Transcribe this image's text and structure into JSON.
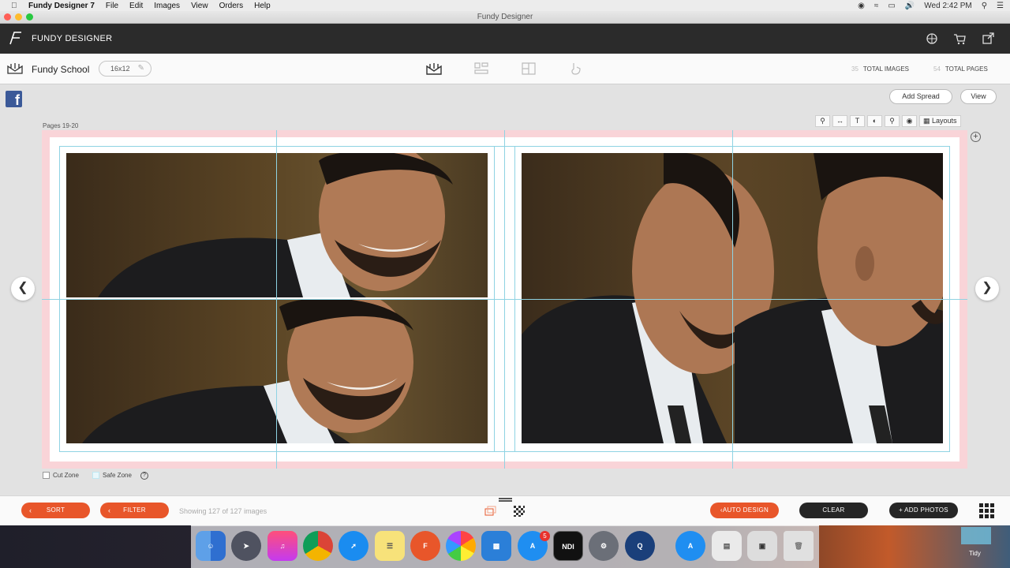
{
  "menubar": {
    "app": "Fundy Designer 7",
    "items": [
      "File",
      "Edit",
      "Images",
      "View",
      "Orders",
      "Help"
    ],
    "clock": "Wed 2:42 PM"
  },
  "window": {
    "title": "Fundy Designer"
  },
  "header": {
    "app_name": "FUNDY DESIGNER"
  },
  "toolbar": {
    "project": "Fundy School",
    "size": "16x12",
    "total_images_count": "35",
    "total_images_label": "TOTAL IMAGES",
    "total_pages_count": "54",
    "total_pages_label": "TOTAL PAGES"
  },
  "workspace": {
    "add_spread": "Add Spread",
    "view": "View",
    "pages_label": "Pages 19-20",
    "layouts": "Layouts",
    "cut_zone": "Cut Zone",
    "safe_zone": "Safe Zone"
  },
  "bottombar": {
    "sort": "SORT",
    "filter": "FILTER",
    "showing": "Showing 127 of 127 images",
    "auto_design": "AUTO DESIGN",
    "clear": "CLEAR",
    "add_photos": "+ ADD PHOTOS"
  },
  "dock": {
    "app_store_badge": "5",
    "ndi_label": "NDI",
    "tidy": "Tidy"
  },
  "colors": {
    "accent": "#e8562a",
    "header_bg": "#2b2b2b",
    "spread_bleed": "#f9d4d8",
    "guide": "#8fd3e3"
  }
}
